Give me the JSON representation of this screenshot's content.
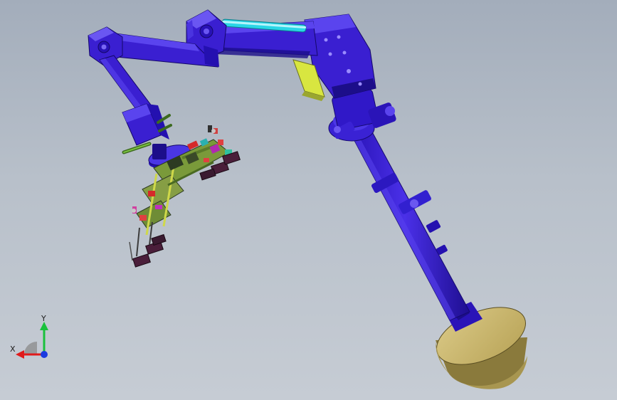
{
  "viewport": {
    "background_top": "#a3adbb",
    "background_bottom": "#c6ccd4"
  },
  "colors": {
    "arm_blue": "#3a1fd1",
    "arm_dark": "#1c0e8a",
    "arm_light": "#5a44ee",
    "base_gold": "#c9b66a",
    "base_gold_dark": "#8a7a3c",
    "cylinder_cyan": "#2ad6e6",
    "panel_yellow": "#d8e640",
    "fixture_green": "#7a9a3a",
    "fixture_dark": "#2c3a22",
    "axis_x": "#e01b1b",
    "axis_y": "#19c13c",
    "axis_z": "#1b3be0"
  },
  "triad": {
    "x_label": "X",
    "y_label": "Y"
  }
}
